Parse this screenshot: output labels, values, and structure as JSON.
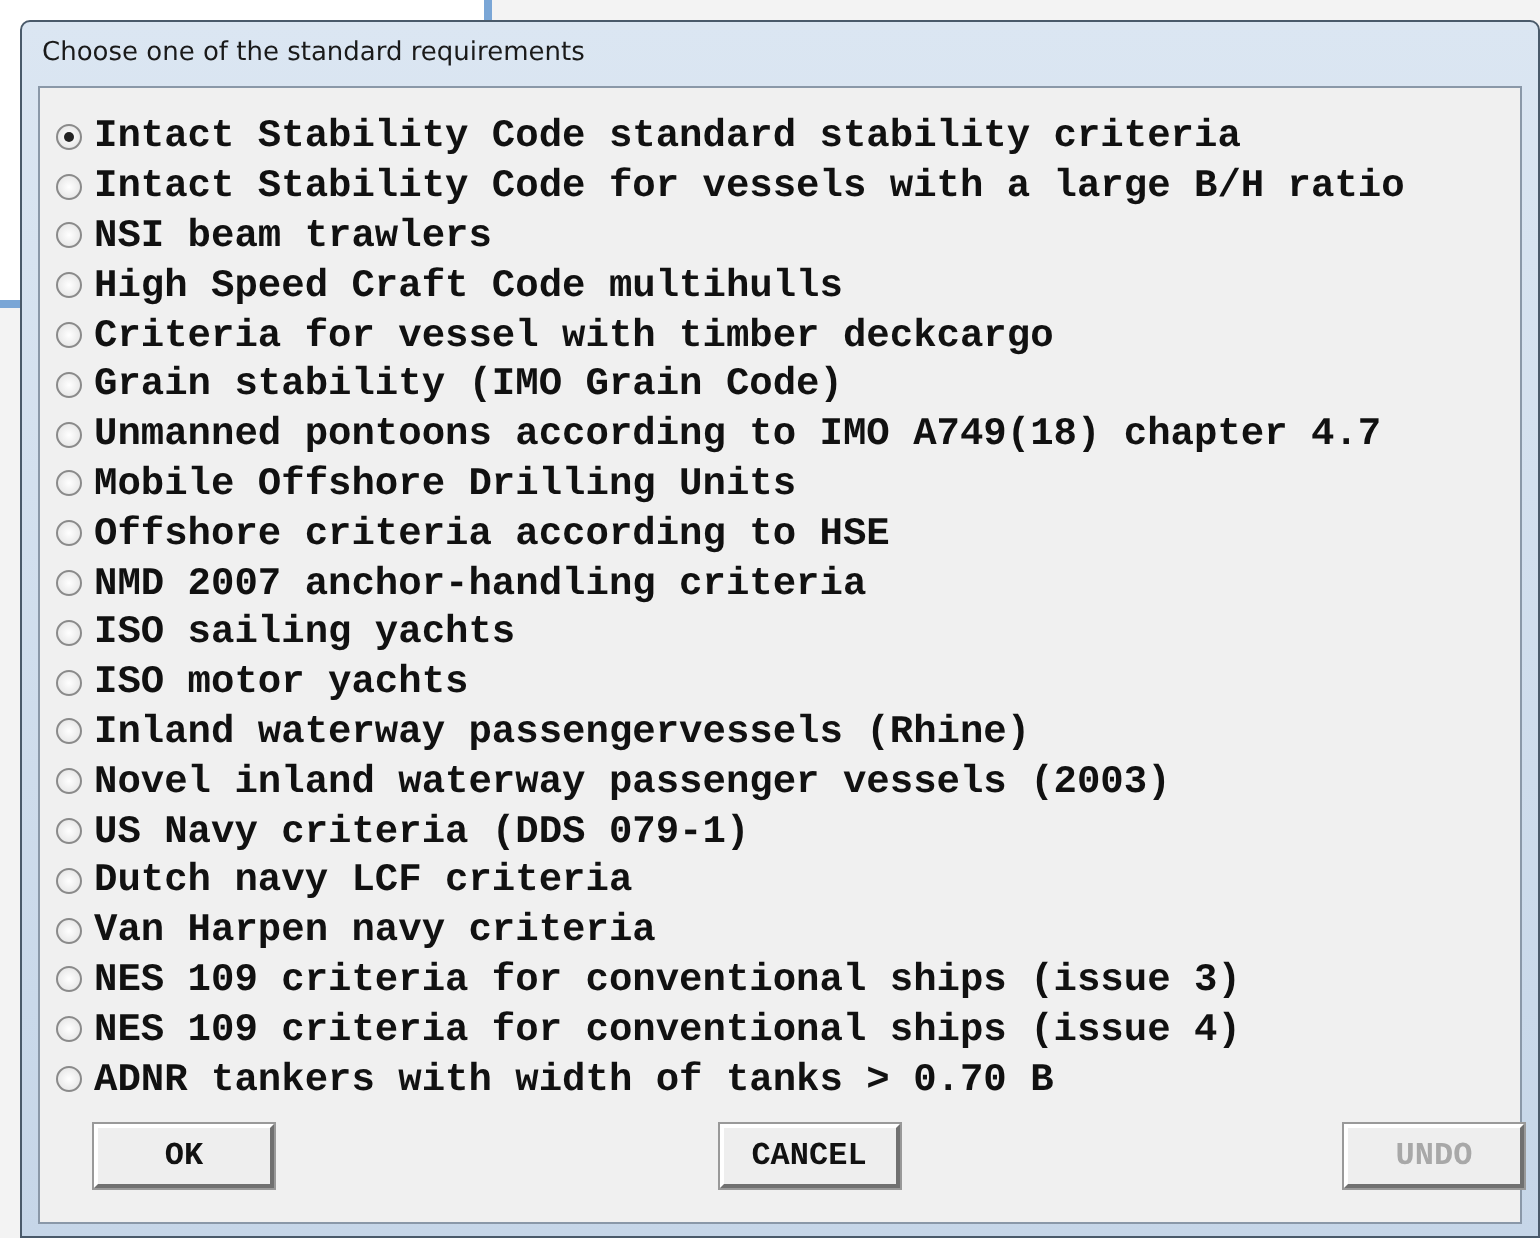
{
  "window": {
    "title": "Choose one of the standard requirements"
  },
  "options": [
    {
      "label": "Intact Stability Code standard stability criteria",
      "selected": true
    },
    {
      "label": "Intact Stability Code for vessels with a large B/H ratio",
      "selected": false
    },
    {
      "label": "NSI beam trawlers",
      "selected": false
    },
    {
      "label": "High Speed Craft Code multihulls",
      "selected": false
    },
    {
      "label": "Criteria for vessel with timber deckcargo",
      "selected": false
    },
    {
      "label": "Grain stability (IMO Grain Code)",
      "selected": false
    },
    {
      "label": "Unmanned pontoons according to IMO A749(18) chapter 4.7",
      "selected": false
    },
    {
      "label": "Mobile Offshore Drilling Units",
      "selected": false
    },
    {
      "label": "Offshore criteria according to HSE",
      "selected": false
    },
    {
      "label": "NMD 2007 anchor-handling criteria",
      "selected": false
    },
    {
      "label": "ISO sailing yachts",
      "selected": false
    },
    {
      "label": "ISO motor yachts",
      "selected": false
    },
    {
      "label": "Inland waterway passengervessels (Rhine)",
      "selected": false
    },
    {
      "label": "Novel inland waterway passenger vessels (2003)",
      "selected": false
    },
    {
      "label": "US Navy criteria (DDS 079-1)",
      "selected": false
    },
    {
      "label": "Dutch navy LCF criteria",
      "selected": false
    },
    {
      "label": "Van Harpen navy criteria",
      "selected": false
    },
    {
      "label": "NES 109 criteria for conventional ships (issue 3)",
      "selected": false
    },
    {
      "label": "NES 109 criteria for conventional ships (issue 4)",
      "selected": false
    },
    {
      "label": "ADNR tankers with width of tanks > 0.70 B",
      "selected": false
    }
  ],
  "buttons": [
    {
      "label": "OK",
      "disabled": false
    },
    {
      "label": "CANCEL",
      "disabled": false
    },
    {
      "label": "UNDO",
      "disabled": true
    }
  ]
}
